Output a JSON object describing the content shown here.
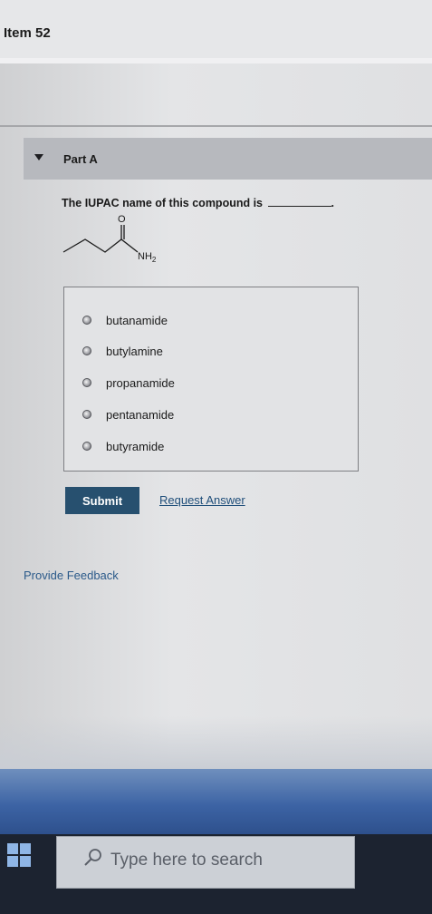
{
  "header": {
    "item_title": "Item 52"
  },
  "part": {
    "label": "Part A"
  },
  "question": {
    "text": "The IUPAC name of this compound is",
    "trailing": "."
  },
  "molecule": {
    "carbonyl_atom": "O",
    "amine_group": "NH",
    "amine_subscript": "2"
  },
  "options": [
    {
      "label": "butanamide"
    },
    {
      "label": "butylamine"
    },
    {
      "label": "propanamide"
    },
    {
      "label": "pentanamide"
    },
    {
      "label": "butyramide"
    }
  ],
  "actions": {
    "submit_label": "Submit",
    "request_answer_label": "Request Answer",
    "provide_feedback_label": "Provide Feedback"
  },
  "taskbar": {
    "search_placeholder": "Type here to search"
  },
  "colors": {
    "submit_bg": "#27506f",
    "link": "#1f4e7a",
    "part_bar": "#b7b9be",
    "taskbar": "#1c2330"
  },
  "icons": {
    "part_toggle": "triangle-down-icon",
    "start": "windows-start-icon",
    "search": "magnifier-icon"
  }
}
